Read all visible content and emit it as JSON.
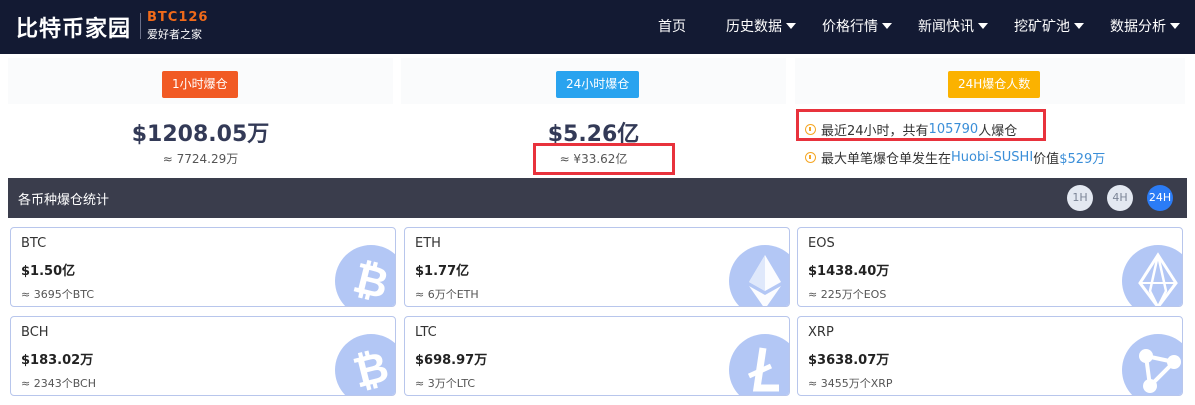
{
  "nav": {
    "logo_main": "比特币家园",
    "logo_brand": "BTC126",
    "logo_tagline": "爱好者之家",
    "items": [
      {
        "label": "首页",
        "has_menu": false
      },
      {
        "label": "历史数据",
        "has_menu": true
      },
      {
        "label": "价格行情",
        "has_menu": true
      },
      {
        "label": "新闻快讯",
        "has_menu": true
      },
      {
        "label": "挖矿矿池",
        "has_menu": true
      },
      {
        "label": "数据分析",
        "has_menu": true
      }
    ]
  },
  "stats": {
    "hour1": {
      "badge": "1小时爆仓",
      "value": "$1208.05万",
      "approx": "≈ 7724.29万"
    },
    "hour24": {
      "badge": "24小时爆仓",
      "value": "$5.26亿",
      "approx": "≈ ¥33.62亿"
    },
    "people": {
      "badge": "24H爆仓人数",
      "line1_prefix": "最近24小时，共有",
      "line1_count": "105790",
      "line1_suffix": "人爆仓",
      "line2_prefix": "最大单笔爆仓单发生在",
      "line2_exchange": "Huobi-SUSHI",
      "line2_mid": "价值",
      "line2_value": "$529万"
    }
  },
  "section": {
    "title": "各币种爆仓统计",
    "periods": [
      "1H",
      "4H",
      "24H"
    ],
    "active_period": "24H"
  },
  "coins": [
    {
      "name": "BTC",
      "value": "$1.50亿",
      "sub": "≈ 3695个BTC",
      "icon": "bitcoin-icon"
    },
    {
      "name": "ETH",
      "value": "$1.77亿",
      "sub": "≈ 6万个ETH",
      "icon": "ethereum-icon"
    },
    {
      "name": "EOS",
      "value": "$1438.40万",
      "sub": "≈ 225万个EOS",
      "icon": "eos-icon"
    },
    {
      "name": "BCH",
      "value": "$183.02万",
      "sub": "≈ 2343个BCH",
      "icon": "bitcoin-cash-icon"
    },
    {
      "name": "LTC",
      "value": "$698.97万",
      "sub": "≈ 3万个LTC",
      "icon": "litecoin-icon"
    },
    {
      "name": "XRP",
      "value": "$3638.07万",
      "sub": "≈ 3455万个XRP",
      "icon": "ripple-icon"
    }
  ],
  "colors": {
    "nav_bg": "#131a33",
    "brand_orange": "#f06a1a",
    "badge_red": "#f15a24",
    "badge_blue": "#29a3ef",
    "badge_yellow": "#fbb200",
    "section_bg": "#3a3d4c",
    "active_blue": "#2b7cf6",
    "link_blue": "#3a8ed8",
    "highlight_red": "#e8323c"
  }
}
